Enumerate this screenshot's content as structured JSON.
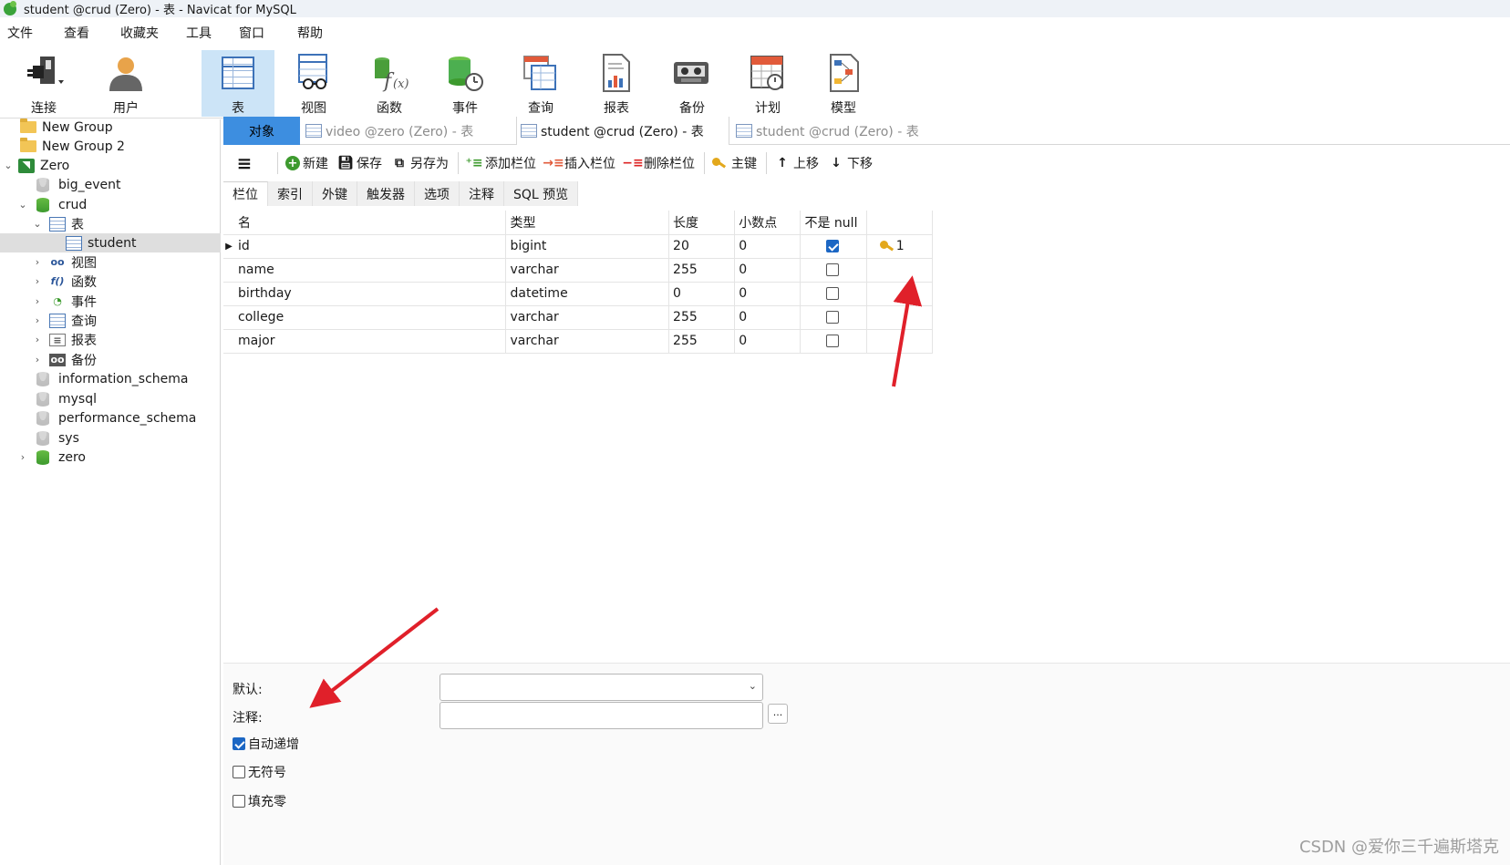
{
  "window": {
    "title": "student @crud (Zero) - 表 - Navicat for MySQL"
  },
  "menu": [
    "文件",
    "查看",
    "收藏夹",
    "工具",
    "窗口",
    "帮助"
  ],
  "toolbar": {
    "connect": "连接",
    "user": "用户",
    "table": "表",
    "view": "视图",
    "function": "函数",
    "event": "事件",
    "query": "查询",
    "report": "报表",
    "backup": "备份",
    "schedule": "计划",
    "model": "模型"
  },
  "sidebar": {
    "items": [
      {
        "label": "New Group",
        "icon": "folder-icon"
      },
      {
        "label": "New Group 2",
        "icon": "folder-icon"
      },
      {
        "label": "Zero",
        "icon": "connection-icon"
      },
      {
        "label": "big_event",
        "icon": "database-icon"
      },
      {
        "label": "crud",
        "icon": "database-icon"
      },
      {
        "label": "表",
        "icon": "table-folder-icon"
      },
      {
        "label": "student",
        "icon": "table-icon"
      },
      {
        "label": "视图",
        "icon": "view-icon"
      },
      {
        "label": "函数",
        "icon": "function-icon"
      },
      {
        "label": "事件",
        "icon": "event-icon"
      },
      {
        "label": "查询",
        "icon": "query-icon"
      },
      {
        "label": "报表",
        "icon": "report-icon"
      },
      {
        "label": "备份",
        "icon": "backup-icon"
      },
      {
        "label": "information_schema",
        "icon": "database-icon"
      },
      {
        "label": "mysql",
        "icon": "database-icon"
      },
      {
        "label": "performance_schema",
        "icon": "database-icon"
      },
      {
        "label": "sys",
        "icon": "database-icon"
      },
      {
        "label": "zero",
        "icon": "database-icon"
      }
    ]
  },
  "tabs": {
    "objects": "对象",
    "tab1": "video @zero (Zero) - 表",
    "tab2": "student @crud (Zero) - 表",
    "tab3": "student @crud (Zero) - 表"
  },
  "edit_toolbar": {
    "new": "新建",
    "save": "保存",
    "save_as": "另存为",
    "add_field": "添加栏位",
    "insert_field": "插入栏位",
    "delete_field": "删除栏位",
    "primary_key": "主键",
    "move_up": "上移",
    "move_down": "下移"
  },
  "subtabs": [
    "栏位",
    "索引",
    "外键",
    "触发器",
    "选项",
    "注释",
    "SQL 预览"
  ],
  "grid": {
    "headers": {
      "name": "名",
      "type": "类型",
      "length": "长度",
      "decimals": "小数点",
      "not_null": "不是 null",
      "key": ""
    },
    "rows": [
      {
        "name": "id",
        "type": "bigint",
        "length": "20",
        "decimals": "0",
        "not_null": true,
        "key": "1"
      },
      {
        "name": "name",
        "type": "varchar",
        "length": "255",
        "decimals": "0",
        "not_null": false,
        "key": ""
      },
      {
        "name": "birthday",
        "type": "datetime",
        "length": "0",
        "decimals": "0",
        "not_null": false,
        "key": ""
      },
      {
        "name": "college",
        "type": "varchar",
        "length": "255",
        "decimals": "0",
        "not_null": false,
        "key": ""
      },
      {
        "name": "major",
        "type": "varchar",
        "length": "255",
        "decimals": "0",
        "not_null": false,
        "key": ""
      }
    ]
  },
  "properties": {
    "default_label": "默认:",
    "default_value": "",
    "comment_label": "注释:",
    "comment_value": "",
    "dots": "...",
    "auto_increment_label": "自动递增",
    "auto_increment": true,
    "unsigned_label": "无符号",
    "unsigned": false,
    "zerofill_label": "填充零",
    "zerofill": false
  },
  "watermark": "CSDN @爱你三千遍斯塔克",
  "colors": {
    "accent": "#3d8ee0",
    "selected_toolbar": "#cce4f7",
    "annotation_arrow": "#e0202a"
  }
}
